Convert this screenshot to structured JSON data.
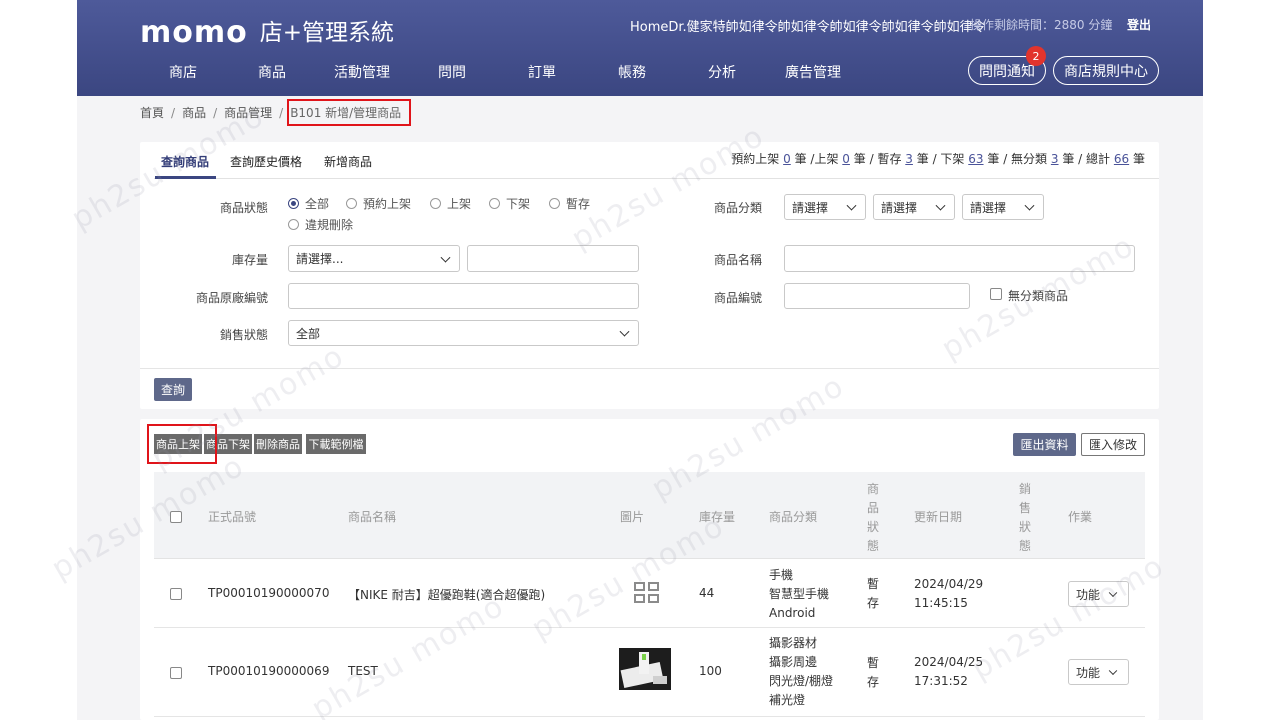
{
  "header": {
    "logo_word": "momo",
    "logo_sub": "店+管理系統",
    "user": "HomeDr.健家特帥如律令帥如律令帥如律令帥如律令帥如律令",
    "timer": "操作剩餘時間：2880 分鐘",
    "logout": "登出",
    "nav": [
      "商店",
      "商品",
      "活動管理",
      "問問",
      "訂單",
      "帳務",
      "分析",
      "廣告管理"
    ],
    "notify_label": "問問通知",
    "notify_count": "2",
    "rules_label": "商店規則中心"
  },
  "breadcrumb": {
    "items": [
      "首頁",
      "商品",
      "商品管理"
    ],
    "sep": "/",
    "current": "B101 新增/管理商品"
  },
  "tabs": [
    "查詢商品",
    "查詢歷史價格",
    "新增商品"
  ],
  "counts": {
    "p1": "預約上架",
    "v1": "0",
    "p2": "筆 /上架",
    "v2": "0",
    "p3": "筆 / 暫存",
    "v3": "3",
    "p4": "筆 / 下架",
    "v4": "63",
    "p5": "筆 / 無分類",
    "v5": "3",
    "p6": "筆 / 總計",
    "v6": "66",
    "p7": "筆"
  },
  "filters": {
    "status_label": "商品狀態",
    "status_options": [
      "全部",
      "預約上架",
      "上架",
      "下架",
      "暫存",
      "違規刪除"
    ],
    "category_label": "商品分類",
    "category_selects": [
      "請選擇",
      "請選擇",
      "請選擇"
    ],
    "stock_label": "庫存量",
    "stock_select": "請選擇...",
    "stock_input": "",
    "name_label": "商品名稱",
    "name_input": "",
    "vendor_code_label": "商品原廠編號",
    "vendor_code_input": "",
    "code_label": "商品編號",
    "code_input": "",
    "uncategorized_label": "無分類商品",
    "sales_label": "銷售狀態",
    "sales_select": "全部",
    "query_button": "查詢"
  },
  "actions": {
    "list_on": "商品上架",
    "list_off": "商品下架",
    "delete": "刪除商品",
    "download": "下載範例檔",
    "export": "匯出資料",
    "import": "匯入修改"
  },
  "table": {
    "columns": {
      "code": "正式品號",
      "name": "商品名稱",
      "image": "圖片",
      "stock": "庫存量",
      "category": "商品分類",
      "status": "商品狀態",
      "updated": "更新日期",
      "sales": "銷售狀態",
      "ops": "作業"
    },
    "rows": [
      {
        "code": "TP00010190000070",
        "name": "【NIKE 耐吉】超優跑鞋(適合超優跑)",
        "stock": "44",
        "category": [
          "手機",
          "智慧型手機",
          "Android"
        ],
        "status": "暫存",
        "date": "2024/04/29",
        "time": "11:45:15",
        "action": "功能"
      },
      {
        "code": "TP00010190000069",
        "name": "TEST",
        "stock": "100",
        "category": [
          "攝影器材",
          "攝影周邊",
          "閃光燈/棚燈",
          "補光燈"
        ],
        "status": "暫存",
        "date": "2024/04/25",
        "time": "17:31:52",
        "action": "功能"
      }
    ]
  },
  "watermark": "ph2su momo"
}
